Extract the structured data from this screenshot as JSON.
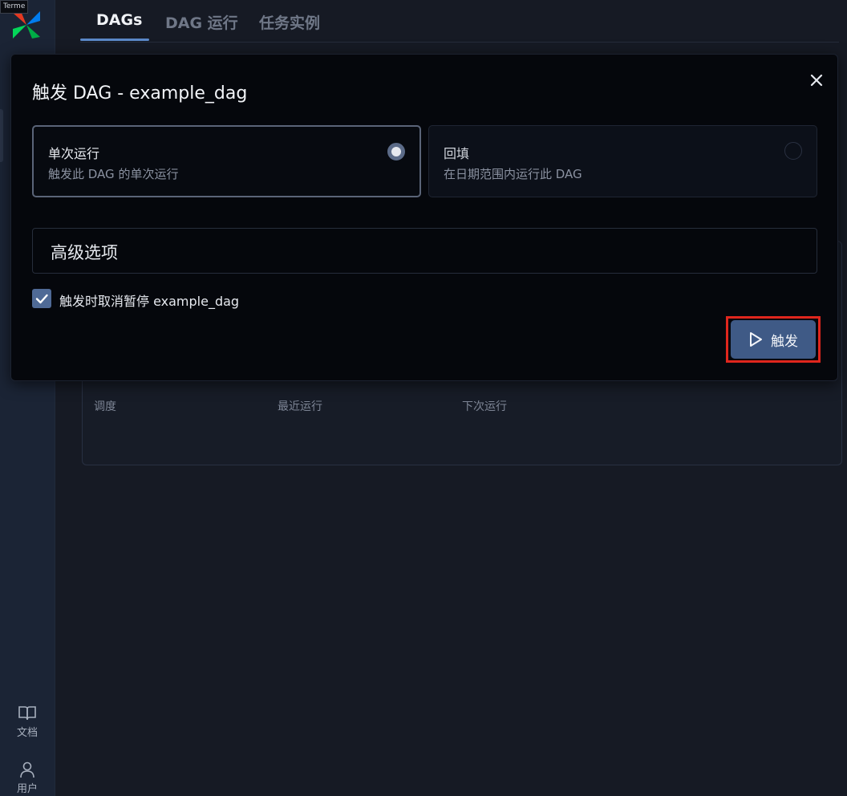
{
  "tooltip": "Terme",
  "tabs": [
    {
      "label": "DAGs",
      "active": true
    },
    {
      "label": "DAG 运行",
      "active": false
    },
    {
      "label": "任务实例",
      "active": false
    }
  ],
  "sidebar": {
    "docs_label": "文档",
    "user_label": "用户"
  },
  "background_table": {
    "columns": [
      "调度",
      "最近运行",
      "下次运行"
    ]
  },
  "modal": {
    "title": "触发 DAG - example_dag",
    "options": [
      {
        "title": "单次运行",
        "subtitle": "触发此 DAG 的单次运行",
        "selected": true
      },
      {
        "title": "回填",
        "subtitle": "在日期范围内运行此 DAG",
        "selected": false
      }
    ],
    "advanced_label": "高级选项",
    "unpause_checkbox": {
      "label": "触发时取消暂停 example_dag",
      "checked": true
    },
    "trigger_button": "触发"
  },
  "colors": {
    "accent": "#4f6a96",
    "highlight": "#e0261d",
    "background": "#161a24",
    "modal_bg": "#05070c"
  },
  "icons": [
    "airflow-logo",
    "close-icon",
    "play-icon",
    "check-icon",
    "book-icon",
    "user-icon"
  ]
}
